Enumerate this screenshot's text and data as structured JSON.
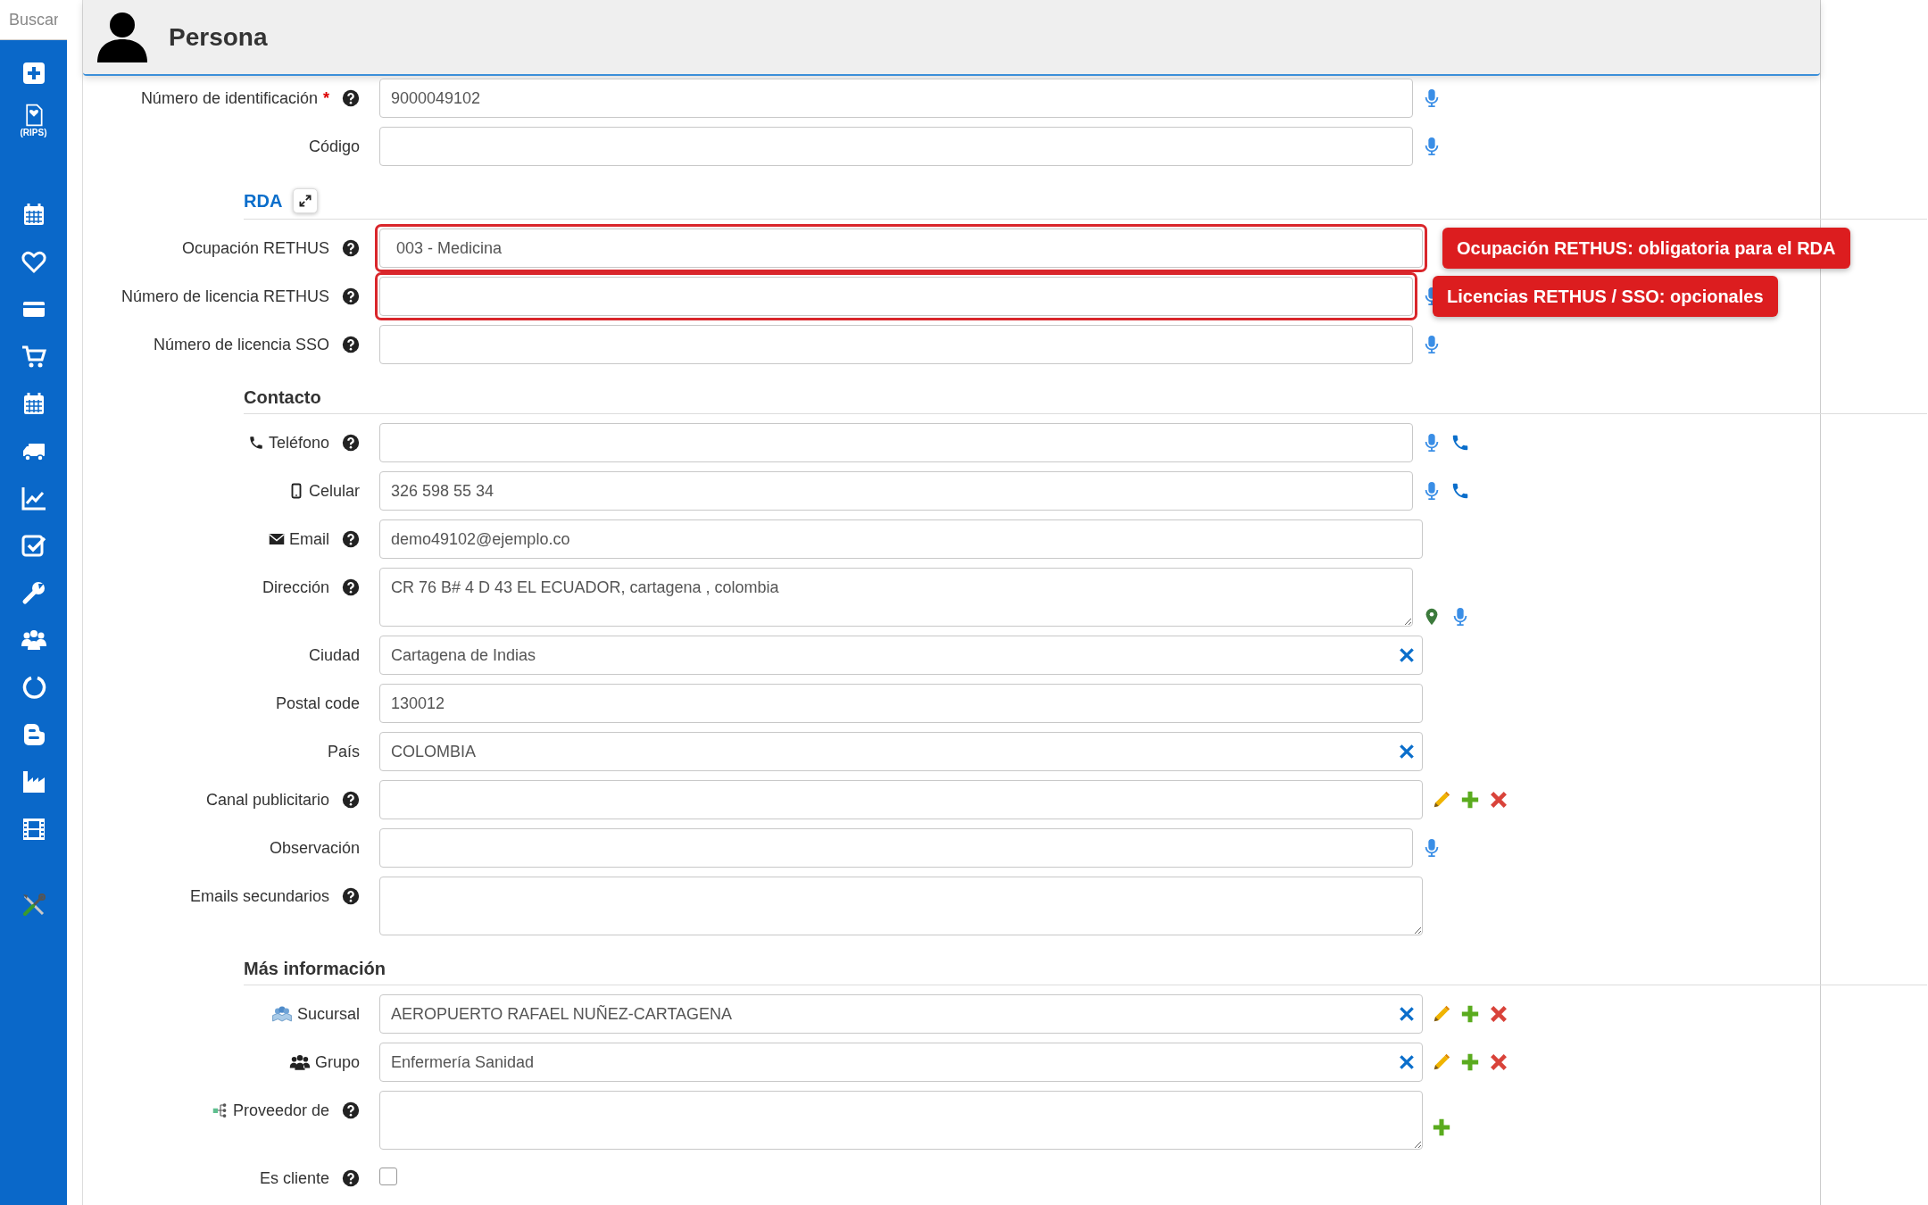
{
  "search": {
    "placeholder": "Buscar"
  },
  "sidebar": {
    "document_caption": "(RIPS)"
  },
  "header": {
    "title": "Persona"
  },
  "form": [
    {
      "kind": "voice",
      "label": "Número de identificación",
      "required_mark": "*",
      "help": true,
      "value": "9000049102"
    },
    {
      "kind": "voice",
      "label": "Código",
      "help": false
    },
    {
      "kind": "collapsible",
      "title": "RDA"
    },
    {
      "kind": "select",
      "label": "Ocupación RETHUS",
      "help": true,
      "highlighted": true,
      "value": "003 - Medicina",
      "callout": "Ocupación RETHUS: obligatoria para el RDA"
    },
    {
      "kind": "voice",
      "label": "Número de licencia RETHUS",
      "help": true,
      "highlighted": true,
      "callout": "Licencias RETHUS / SSO: opcionales"
    },
    {
      "kind": "voice",
      "label": "Número de licencia SSO",
      "help": true
    },
    {
      "kind": "section",
      "title": "Contacto"
    },
    {
      "kind": "phone",
      "label": "Teléfono",
      "help": true
    },
    {
      "kind": "mobile",
      "label": "Celular",
      "help": false,
      "value": "326 598 55 34"
    },
    {
      "kind": "email",
      "label": "Email",
      "help": true,
      "value": "demo49102@ejemplo.co"
    },
    {
      "kind": "address",
      "label": "Dirección",
      "help": true,
      "value": "CR 76 B# 4 D 43 EL ECUADOR, cartagena , colombia"
    },
    {
      "kind": "clearable",
      "label": "Ciudad",
      "help": false,
      "value": "Cartagena de Indias"
    },
    {
      "kind": "plain",
      "label": "Postal code",
      "help": false,
      "value": "130012"
    },
    {
      "kind": "clearable",
      "label": "País",
      "help": false,
      "value": "COLOMBIA"
    },
    {
      "kind": "catalog",
      "label": "Canal publicitario",
      "help": true
    },
    {
      "kind": "voice",
      "label": "Observación",
      "help": false
    },
    {
      "kind": "multiline",
      "label": "Emails secundarios",
      "help": true
    },
    {
      "kind": "section",
      "title": "Más información"
    },
    {
      "kind": "branch",
      "label": "Sucursal",
      "help": false,
      "value": "AEROPUERTO RAFAEL NUÑEZ-CARTAGENA"
    },
    {
      "kind": "group",
      "label": "Grupo",
      "help": false,
      "value": "Enfermería Sanidad"
    },
    {
      "kind": "supplier",
      "label": "Proveedor de",
      "help": true
    },
    {
      "kind": "checkbox",
      "label": "Es cliente",
      "help": true,
      "checked": false
    }
  ]
}
